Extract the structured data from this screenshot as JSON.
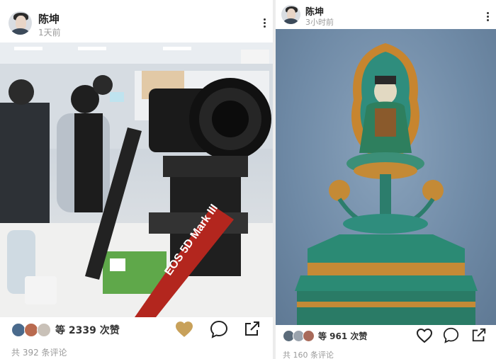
{
  "posts": [
    {
      "author": "陈坤",
      "time": "1天前",
      "likes_text": "等 2339 次赞",
      "comments_text": "共 392 条评论",
      "liked": true,
      "camera_label": "EOS 5D Mark III",
      "accent_like": "#c8a15a"
    },
    {
      "author": "陈坤",
      "time": "3小时前",
      "likes_text": "等 961 次赞",
      "comments_text": "共 160 条评论",
      "liked": false
    }
  ]
}
